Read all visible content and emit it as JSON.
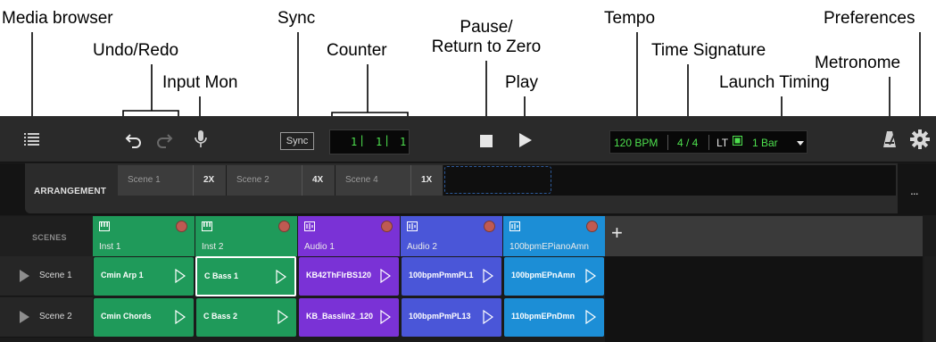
{
  "annotations": {
    "media_browser": "Media browser",
    "undo_redo": "Undo/Redo",
    "input_mon": "Input Mon",
    "sync": "Sync",
    "counter": "Counter",
    "pause_line1": "Pause/",
    "pause_line2": "Return to Zero",
    "play": "Play",
    "tempo": "Tempo",
    "time_signature": "Time Signature",
    "preferences": "Preferences",
    "metronome": "Metronome",
    "launch_timing": "Launch Timing"
  },
  "toolbar": {
    "sync_label": "Sync",
    "counter": {
      "bars": "1",
      "beats": "1",
      "ticks": "1"
    },
    "tempo": "120 BPM",
    "time_signature": "4 / 4",
    "launch_timing_label": "LT",
    "launch_timing_value": "1 Bar"
  },
  "arrangement": {
    "label": "ARRANGEMENT",
    "scenes": [
      {
        "name": "Scene 1",
        "repeat": "2X"
      },
      {
        "name": "Scene 2",
        "repeat": "4X"
      },
      {
        "name": "Scene 4",
        "repeat": "1X"
      }
    ],
    "more": "..."
  },
  "scenes_header": "SCENES",
  "add_track_label": "+",
  "tracks": [
    {
      "name": "Inst 1",
      "icon": "piano-icon",
      "color": "#1f9a5a"
    },
    {
      "name": "Inst 2",
      "icon": "piano-icon",
      "color": "#1f9a5a"
    },
    {
      "name": "Audio 1",
      "icon": "waveform-icon",
      "color": "#7a32d6"
    },
    {
      "name": "Audio 2",
      "icon": "waveform-icon",
      "color": "#4a56d8"
    },
    {
      "name": "100bpmEPianoAmn",
      "icon": "waveform-icon",
      "color": "#1c8ed6"
    }
  ],
  "scene_rows": [
    {
      "name": "Scene 1",
      "clips": [
        "Cmin Arp 1",
        "C Bass 1",
        "KB42ThFlrBS120",
        "100bpmPmmPL1",
        "100bpmEPnAmn"
      ]
    },
    {
      "name": "Scene 2",
      "clips": [
        "Cmin Chords",
        "C Bass 2",
        "KB_Basslin2_120",
        "100bpmPmPL13",
        "110bpmEPnDmn"
      ]
    }
  ],
  "colors": {
    "toolbar_bg": "#2a2a2a",
    "lcd_green": "#4ee04e",
    "inst_green": "#1f9a5a",
    "audio1_purple": "#7a32d6",
    "audio2_blue": "#4a56d8",
    "epiano_blue": "#1c8ed6"
  }
}
